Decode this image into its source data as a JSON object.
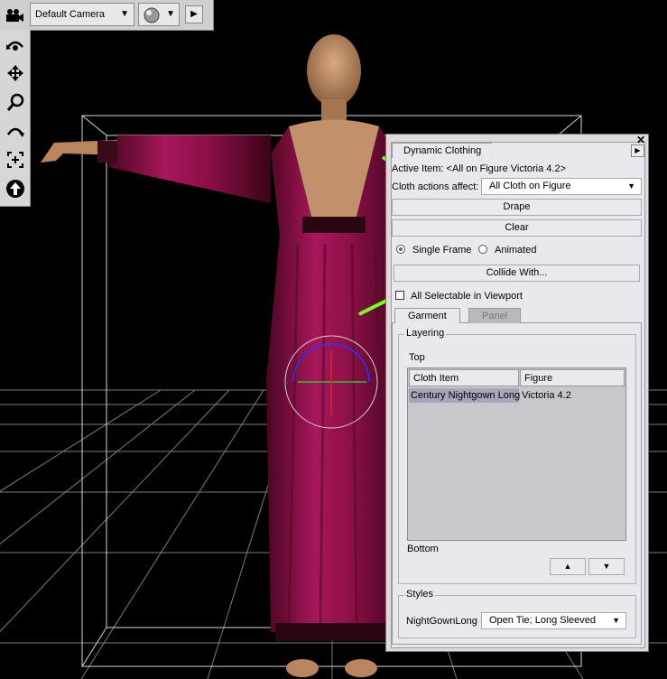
{
  "toolbar": {
    "camera_label": "Default Camera",
    "camera_arrow": "▼",
    "shade_arrow": "▼",
    "play_symbol": "▶"
  },
  "left_tools": [
    "camera-icon",
    "orbit-icon",
    "move-icon",
    "zoom-icon",
    "rotate-icon",
    "frame-icon",
    "up-arrow-icon"
  ],
  "panel": {
    "tab_title": "Dynamic Clothing",
    "close": "✕",
    "menu": "▶",
    "active_item": "Active Item: <All on Figure Victoria 4.2>",
    "cloth_actions_label": "Cloth actions affect:",
    "cloth_actions_value": "All Cloth on Figure",
    "drape_label": "Drape",
    "clear_label": "Clear",
    "single_frame_label": "Single Frame",
    "animated_label": "Animated",
    "collide_label": "Collide With...",
    "all_selectable_label": "All Selectable in Viewport",
    "tabs": [
      "Garment",
      "Panel"
    ],
    "layering_title": "Layering",
    "top_label": "Top",
    "bottom_label": "Bottom",
    "table": {
      "headers": [
        "Cloth Item",
        "Figure"
      ],
      "rows": [
        [
          "Century Nightgown Long",
          "Victoria 4.2"
        ]
      ]
    },
    "up_symbol": "▲",
    "down_symbol": "▼",
    "styles_title": "Styles",
    "style_name": "NightGownLong",
    "style_value": "Open Tie; Long Sleeved"
  },
  "colors": {
    "gown": "#a0144f",
    "skin": "#c89a72",
    "arrow": "#7dff2a",
    "panel_bg": "#e9e9ed"
  }
}
